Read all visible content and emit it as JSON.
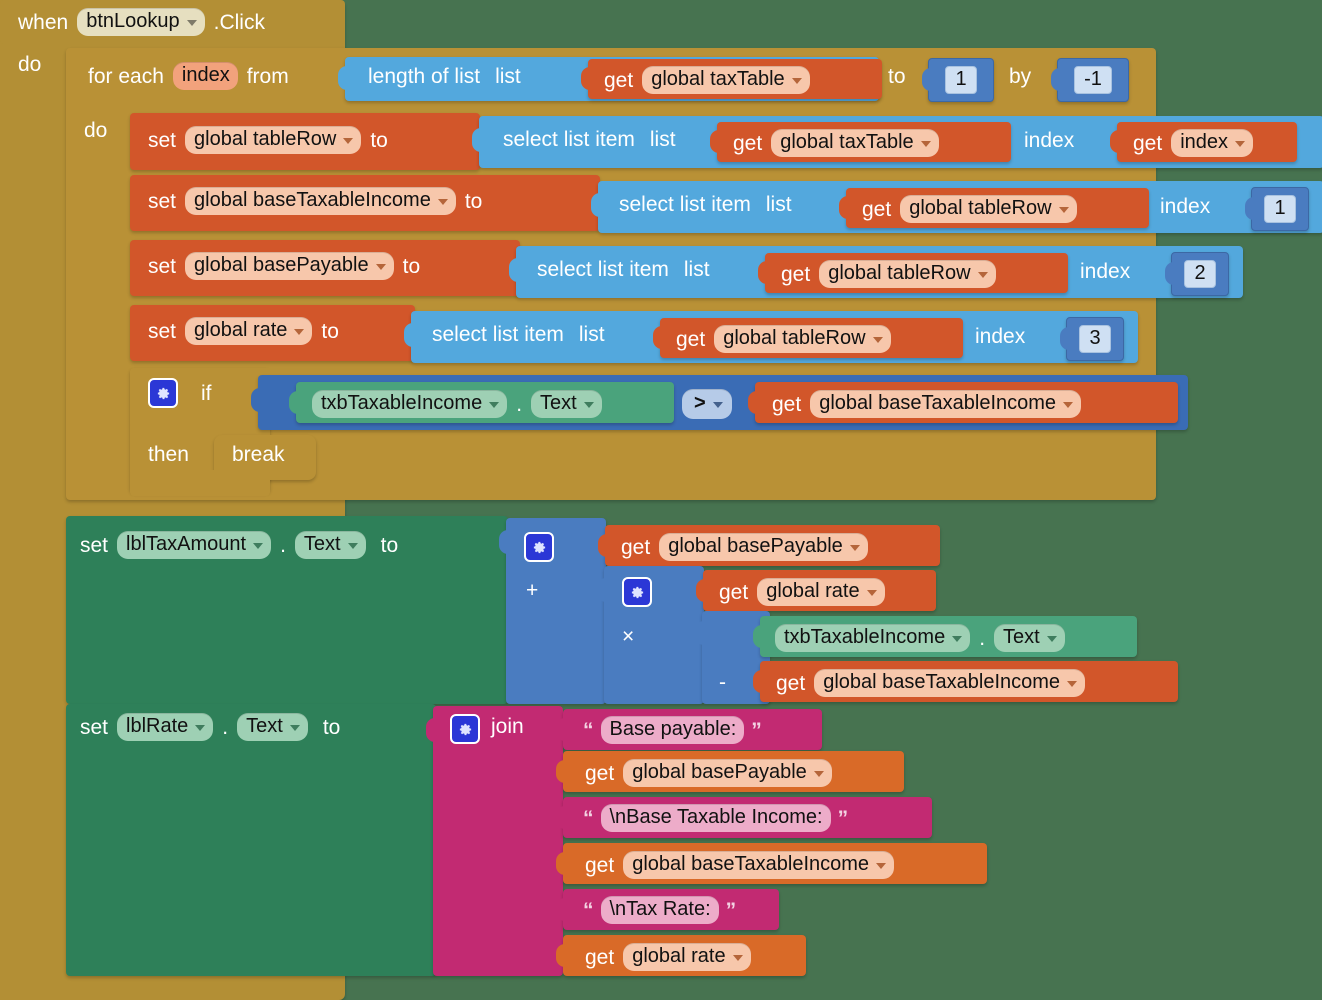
{
  "canvas": {
    "background_color": "#477350",
    "app": "MIT App Inventor Blocks Editor"
  },
  "colors": {
    "event": "#b38f35",
    "control": "#b99136",
    "variable": "#d2562a",
    "variable_get": "#d96a28",
    "list": "#53a8dd",
    "component_set": "#2e8059",
    "component_get": "#4aa37c",
    "math": "#4a7cc0",
    "logic": "#3a6cb5",
    "text": "#c22a72",
    "number_socket": "#4a7cc0"
  },
  "event_block": {
    "when": "when",
    "component": "btnLookup",
    "event": ".Click",
    "do": "do"
  },
  "for_each": {
    "for_each": "for each",
    "loop_var": "index",
    "from": "from",
    "to": "to",
    "by": "by",
    "from_value_block": {
      "label": "length of list",
      "arg_label": "list",
      "get": "get",
      "variable": "global taxTable"
    },
    "to_value": "1",
    "by_value": "-1",
    "do": "do"
  },
  "statements": [
    {
      "set": "set",
      "variable": "global tableRow",
      "to": "to",
      "value": {
        "label": "select list item",
        "list_label": "list",
        "list_get": "get",
        "list_var": "global taxTable",
        "index_label": "index",
        "index_get": "get",
        "index_var": "index",
        "index_is_get": true
      }
    },
    {
      "set": "set",
      "variable": "global baseTaxableIncome",
      "to": "to",
      "value": {
        "label": "select list item",
        "list_label": "list",
        "list_get": "get",
        "list_var": "global tableRow",
        "index_label": "index",
        "index_value": "1",
        "index_is_get": false
      }
    },
    {
      "set": "set",
      "variable": "global basePayable",
      "to": "to",
      "value": {
        "label": "select list item",
        "list_label": "list",
        "list_get": "get",
        "list_var": "global tableRow",
        "index_label": "index",
        "index_value": "2",
        "index_is_get": false
      }
    },
    {
      "set": "set",
      "variable": "global rate",
      "to": "to",
      "value": {
        "label": "select list item",
        "list_label": "list",
        "list_get": "get",
        "list_var": "global tableRow",
        "index_label": "index",
        "index_value": "3",
        "index_is_get": false
      }
    }
  ],
  "if_block": {
    "if": "if",
    "then": "then",
    "break": "break",
    "condition": {
      "left_component": "txbTaxableIncome",
      "dot": ".",
      "left_property": "Text",
      "operator": ">",
      "right_get": "get",
      "right_var": "global baseTaxableIncome"
    }
  },
  "set_tax_amount": {
    "set": "set",
    "component": "lblTaxAmount",
    "dot": ".",
    "property": "Text",
    "to": "to",
    "expression": {
      "plus_op": "+",
      "first_get": "get",
      "first_var": "global basePayable",
      "times_op": "×",
      "rate_get": "get",
      "rate_var": "global rate",
      "minus_op": "-",
      "income_component": "txbTaxableIncome",
      "income_dot": ".",
      "income_property": "Text",
      "base_get": "get",
      "base_var": "global baseTaxableIncome"
    }
  },
  "set_rate": {
    "set": "set",
    "component": "lblRate",
    "dot": ".",
    "property": "Text",
    "to": "to",
    "join_label": "join",
    "items": [
      {
        "kind": "text",
        "value": "Base payable:"
      },
      {
        "kind": "get",
        "get": "get",
        "value": "global basePayable"
      },
      {
        "kind": "text",
        "value": "\\nBase Taxable Income:"
      },
      {
        "kind": "get",
        "get": "get",
        "value": "global baseTaxableIncome"
      },
      {
        "kind": "text",
        "value": "\\nTax Rate:"
      },
      {
        "kind": "get",
        "get": "get",
        "value": "global rate"
      }
    ]
  },
  "icons": {
    "gear": "gear-icon",
    "caret": "chevron-down-icon",
    "open_quote": "“",
    "close_quote": "”"
  }
}
